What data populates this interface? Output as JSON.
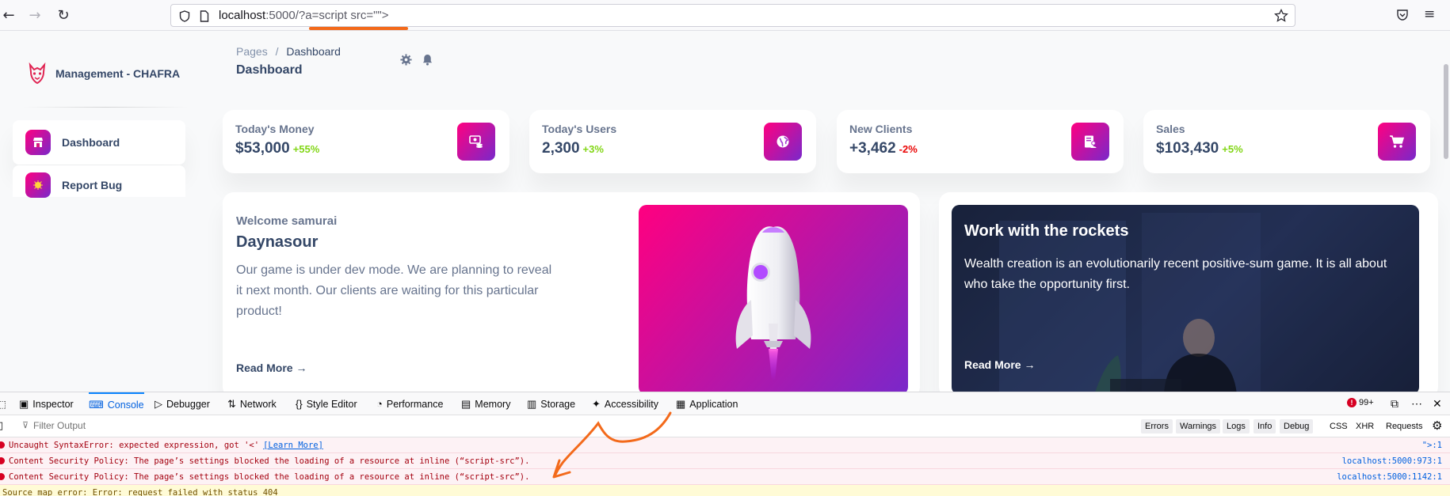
{
  "browser": {
    "url_host": "localhost",
    "url_rest": ":5000/?a=script src=\"\">",
    "colors": {
      "annotation": "#f36a1b"
    }
  },
  "sidebar": {
    "brand": "Management - CHAFRA",
    "items": [
      {
        "label": "Dashboard",
        "icon": "shop-icon",
        "active": true
      },
      {
        "label": "Report Bug",
        "icon": "bug-icon",
        "active": false
      }
    ]
  },
  "header": {
    "breadcrumb_root": "Pages",
    "breadcrumb_sep": "/",
    "breadcrumb_current": "Dashboard",
    "title": "Dashboard"
  },
  "stats": [
    {
      "label": "Today's Money",
      "value": "$53,000",
      "change": "+55%",
      "trend": "pos",
      "icon": "money-icon"
    },
    {
      "label": "Today's Users",
      "value": "2,300",
      "change": "+3%",
      "trend": "pos",
      "icon": "globe-icon"
    },
    {
      "label": "New Clients",
      "value": "+3,462",
      "change": "-2%",
      "trend": "neg",
      "icon": "document-icon"
    },
    {
      "label": "Sales",
      "value": "$103,430",
      "change": "+5%",
      "trend": "pos",
      "icon": "cart-icon"
    }
  ],
  "welcome": {
    "greeting": "Welcome samurai",
    "title": "Daynasour",
    "text": "Our game is under dev mode. We are planning to reveal it next month. Our clients are waiting for this particular product!",
    "read_more": "Read More"
  },
  "rockets": {
    "title": "Work with the rockets",
    "text": "Wealth creation is an evolutionarily recent positive-sum game. It is all about who take the opportunity first.",
    "read_more": "Read More"
  },
  "devtools": {
    "tabs": [
      "Inspector",
      "Console",
      "Debugger",
      "Network",
      "Style Editor",
      "Performance",
      "Memory",
      "Storage",
      "Accessibility",
      "Application"
    ],
    "active_tab": "Console",
    "error_count": "99+",
    "filter_placeholder": "Filter Output",
    "filters": [
      "Errors",
      "Warnings",
      "Logs",
      "Info",
      "Debug"
    ],
    "extra_filters": [
      "CSS",
      "XHR",
      "Requests"
    ],
    "messages": [
      {
        "text": "Uncaught SyntaxError: expected expression, got '<'",
        "link": "[Learn More]",
        "source": "\">:1",
        "level": "error"
      },
      {
        "text": "Content Security Policy: The page’s settings blocked the loading of a resource at inline (“script-src”).",
        "source": "localhost:5000:973:1",
        "level": "error"
      },
      {
        "text": "Content Security Policy: The page’s settings blocked the loading of a resource at inline (“script-src”).",
        "source": "localhost:5000:1142:1",
        "level": "error"
      },
      {
        "text": "Source map error: Error: request failed with status 404",
        "source": "",
        "level": "warn"
      }
    ]
  }
}
